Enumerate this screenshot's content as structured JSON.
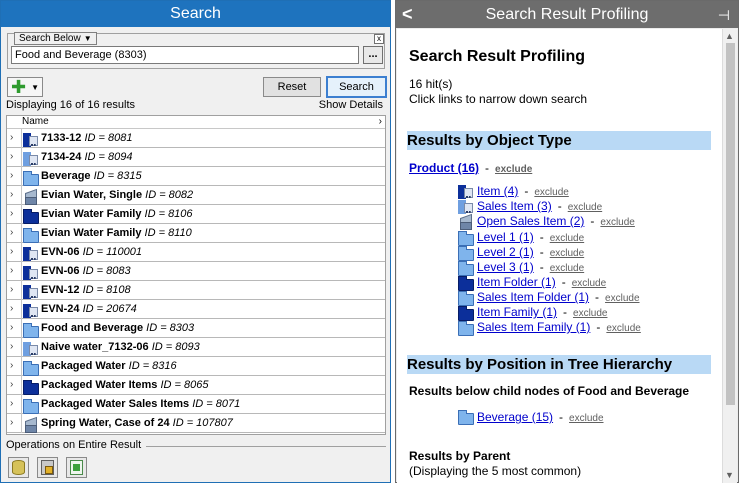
{
  "left_panel": {
    "title": "Search",
    "search": {
      "scope_label": "Search Below",
      "value": "Food and Beverage (8303)",
      "close_symbol": "x",
      "browse_label": "..."
    },
    "toolbar": {
      "add_symbol": "✚",
      "reset_label": "Reset",
      "search_label": "Search"
    },
    "results_count": "Displaying 16 of 16 results",
    "show_details": "Show Details",
    "table": {
      "column_header": "Name",
      "rows": [
        {
          "name": "7133-12",
          "id": "ID = 8081",
          "icon": "item-icon"
        },
        {
          "name": "7134-24",
          "id": "ID = 8094",
          "icon": "sales-item-icon"
        },
        {
          "name": "Beverage",
          "id": "ID = 8315",
          "icon": "folder-icon"
        },
        {
          "name": "Evian Water, Single",
          "id": "ID = 8082",
          "icon": "cube-icon"
        },
        {
          "name": "Evian Water Family",
          "id": "ID = 8106",
          "icon": "item-family-icon"
        },
        {
          "name": "Evian Water Family",
          "id": "ID = 8110",
          "icon": "folder-icon"
        },
        {
          "name": "EVN-06",
          "id": "ID = 110001",
          "icon": "item-icon"
        },
        {
          "name": "EVN-06",
          "id": "ID = 8083",
          "icon": "item-icon"
        },
        {
          "name": "EVN-12",
          "id": "ID = 8108",
          "icon": "item-icon"
        },
        {
          "name": "EVN-24",
          "id": "ID = 20674",
          "icon": "item-icon"
        },
        {
          "name": "Food and Beverage",
          "id": "ID = 8303",
          "icon": "folder-icon"
        },
        {
          "name": "Naive water_7132-06",
          "id": "ID = 8093",
          "icon": "sales-item-icon"
        },
        {
          "name": "Packaged Water",
          "id": "ID = 8316",
          "icon": "folder-icon"
        },
        {
          "name": "Packaged Water Items",
          "id": "ID = 8065",
          "icon": "item-folder-icon"
        },
        {
          "name": "Packaged Water Sales Items",
          "id": "ID = 8071",
          "icon": "folder-icon"
        },
        {
          "name": "Spring Water, Case of 24",
          "id": "ID = 107807",
          "icon": "cube-icon"
        }
      ]
    },
    "operations_label": "Operations on Entire Result"
  },
  "right_panel": {
    "title": "Search Result Profiling",
    "heading": "Search Result Profiling",
    "hits": "16 hit(s)",
    "hint": "Click links to narrow down search",
    "section_object_type": "Results by Object Type",
    "product_link": "Product (16)",
    "exclude_label": "exclude",
    "object_types": [
      {
        "label": "Item (4)",
        "icon": "item-icon"
      },
      {
        "label": "Sales Item (3)",
        "icon": "sales-item-icon"
      },
      {
        "label": "Open Sales Item (2)",
        "icon": "cube-icon"
      },
      {
        "label": "Level 1 (1)",
        "icon": "folder-icon"
      },
      {
        "label": "Level 2 (1)",
        "icon": "folder-icon"
      },
      {
        "label": "Level 3 (1)",
        "icon": "folder-icon"
      },
      {
        "label": "Item Folder (1)",
        "icon": "item-folder-icon"
      },
      {
        "label": "Sales Item Folder (1)",
        "icon": "folder-icon"
      },
      {
        "label": "Item Family (1)",
        "icon": "item-folder-icon"
      },
      {
        "label": "Sales Item Family (1)",
        "icon": "folder-icon"
      }
    ],
    "section_position": "Results by Position in Tree Hierarchy",
    "below_label": "Results below child nodes of Food and Beverage",
    "beverage_link": "Beverage (15)",
    "parent_label": "Results by Parent",
    "parent_note": "(Displaying the 5 most common)",
    "back_symbol": "<",
    "pin_symbol": "⊣"
  }
}
